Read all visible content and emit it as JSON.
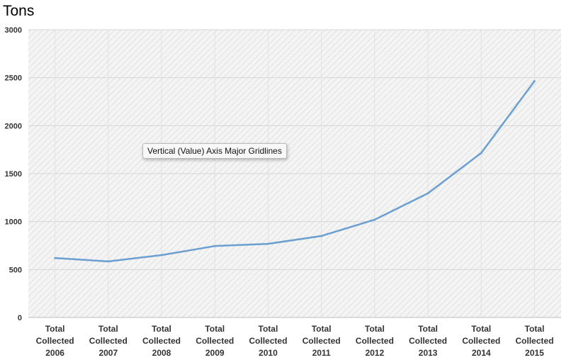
{
  "chart_data": {
    "type": "line",
    "ylabel": "Tons",
    "xlabel": "",
    "title": "",
    "categories": [
      [
        "Total",
        "Collected",
        "2006"
      ],
      [
        "Total",
        "Collected",
        "2007"
      ],
      [
        "Total",
        "Collected",
        "2008"
      ],
      [
        "Total",
        "Collected",
        "2009"
      ],
      [
        "Total",
        "Collected",
        "2010"
      ],
      [
        "Total",
        "Collected",
        "2011"
      ],
      [
        "Total",
        "Collected",
        "2012"
      ],
      [
        "Total",
        "Collected",
        "2013"
      ],
      [
        "Total",
        "Collected",
        "2014"
      ],
      [
        "Total",
        "Collected",
        "2015"
      ]
    ],
    "series": [
      {
        "values": [
          620,
          585,
          650,
          745,
          768,
          850,
          1020,
          1295,
          1715,
          2465
        ],
        "color": "#6a9fcf"
      }
    ],
    "ylim": [
      0,
      3000
    ],
    "yticks": [
      0,
      500,
      1000,
      1500,
      2000,
      2500,
      3000
    ],
    "grid": true,
    "legend": "none",
    "plot_background": "hatched-light-gray"
  },
  "tooltip": {
    "text": "Vertical (Value) Axis Major Gridlines"
  }
}
